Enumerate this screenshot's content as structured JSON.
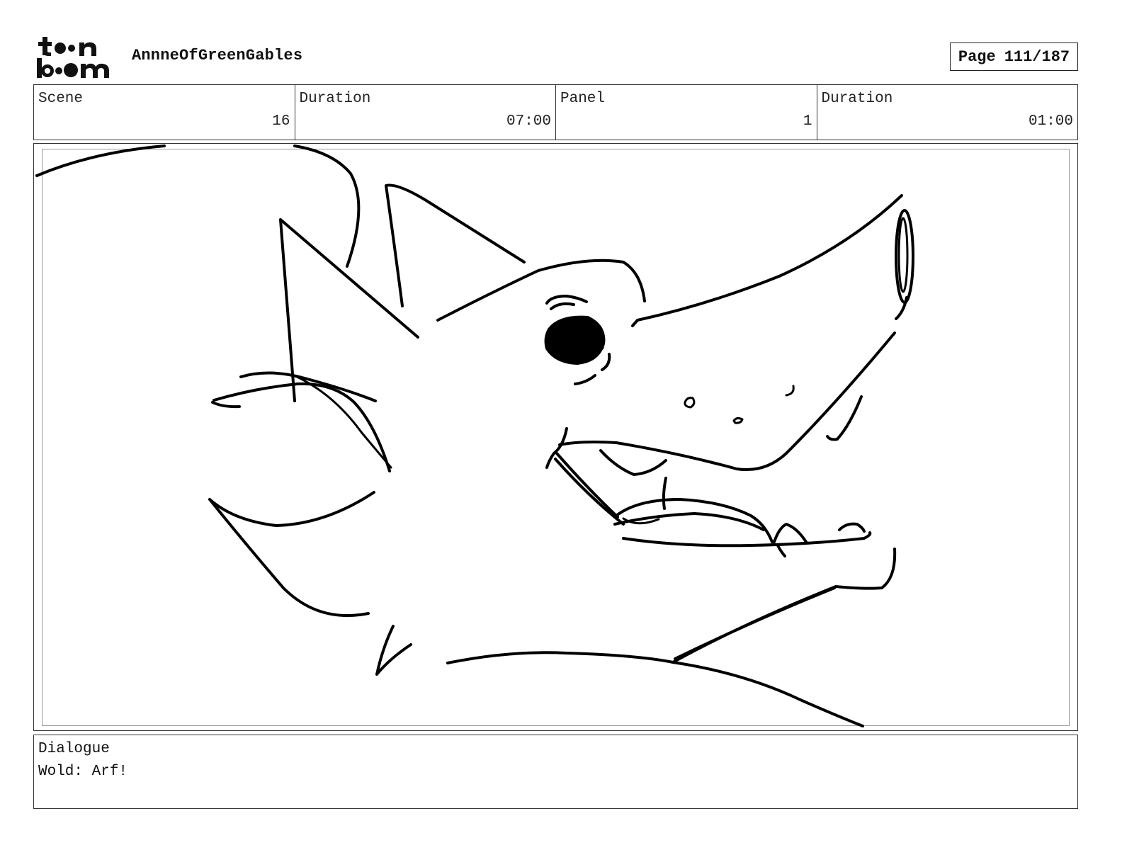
{
  "header": {
    "logo_text": "toon boom",
    "project_title": "AnnneOfGreenGables",
    "page_label": "Page",
    "page_value": "111/187"
  },
  "info": {
    "scene_label": "Scene",
    "scene_value": "16",
    "scene_duration_label": "Duration",
    "scene_duration_value": "07:00",
    "panel_label": "Panel",
    "panel_value": "1",
    "panel_duration_label": "Duration",
    "panel_duration_value": "01:00"
  },
  "panel": {
    "image": "wolf-head-sketch"
  },
  "dialogue": {
    "label": "Dialogue",
    "text": "Wold: Arf!"
  }
}
